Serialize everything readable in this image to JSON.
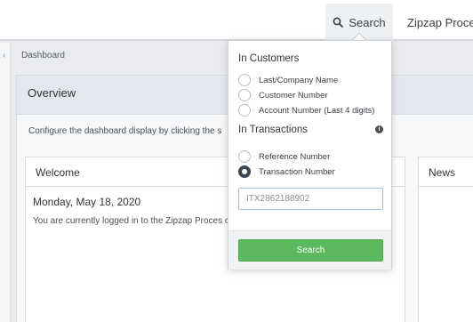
{
  "topnav": {
    "search_label": "Search",
    "brand_label": "Zipzap Proces"
  },
  "breadcrumb": "Dashboard",
  "overview": {
    "title": "Overview",
    "description": "Configure the dashboard display by clicking the s"
  },
  "welcome": {
    "title": "Welcome",
    "date": "Monday, May 18, 2020",
    "text": "You are currently logged in to the Zipzap Proces online system."
  },
  "news": {
    "title": "News"
  },
  "search_dropdown": {
    "customers_title": "In Customers",
    "customer_options": [
      {
        "label": "Last/Company Name",
        "checked": false
      },
      {
        "label": "Customer Number",
        "checked": false
      },
      {
        "label": "Account Number (Last 4 digits)",
        "checked": false
      }
    ],
    "transactions_title": "In Transactions",
    "transaction_options": [
      {
        "label": "Reference Number",
        "checked": false
      },
      {
        "label": "Transaction Number",
        "checked": true
      }
    ],
    "input_placeholder": "ITX2862188902",
    "search_button": "Search"
  },
  "colors": {
    "search_button": "#5cb85c",
    "header_bg": "#e4e8ee",
    "page_bg": "#e9ebee"
  },
  "icons": {
    "search": "search-icon",
    "info": "info-icon",
    "collapse": "chevron-left-icon"
  }
}
